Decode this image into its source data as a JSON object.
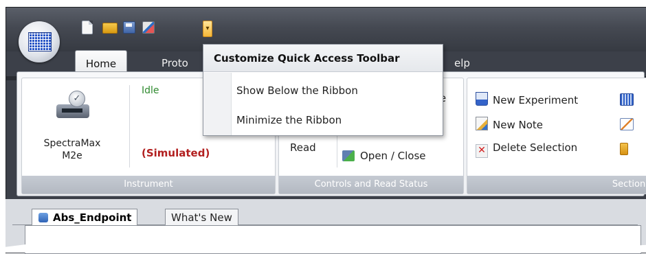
{
  "quick_access": {
    "customize_glyph": "▾"
  },
  "tabs": {
    "home": "Home",
    "proto_partial": "Proto",
    "help_partial": "elp"
  },
  "menu": {
    "title": "Customize Quick Access Toolbar",
    "items": [
      "Show Below the Ribbon",
      "Minimize the Ribbon"
    ]
  },
  "instrument": {
    "name_line1": "SpectraMax",
    "name_line2": "M2e",
    "status_idle": "Idle",
    "status_simulated": "(Simulated)",
    "label": "Instrument"
  },
  "controls": {
    "partial_text": "re",
    "read_label": "Read",
    "open_close": "Open / Close",
    "label": "Controls and Read Status"
  },
  "sections": {
    "new_experiment": "New Experiment",
    "new_note": "New Note",
    "delete_selection": "Delete Selection",
    "label": "Sections"
  },
  "documents": {
    "tabs": [
      "Abs_Endpoint",
      "What's New"
    ]
  },
  "colors": {
    "status_idle": "#2f8a2f",
    "status_simulated": "#b21f1f",
    "window_dark": "#3c4049",
    "ribbon_group_label": "#b3b9c2"
  }
}
